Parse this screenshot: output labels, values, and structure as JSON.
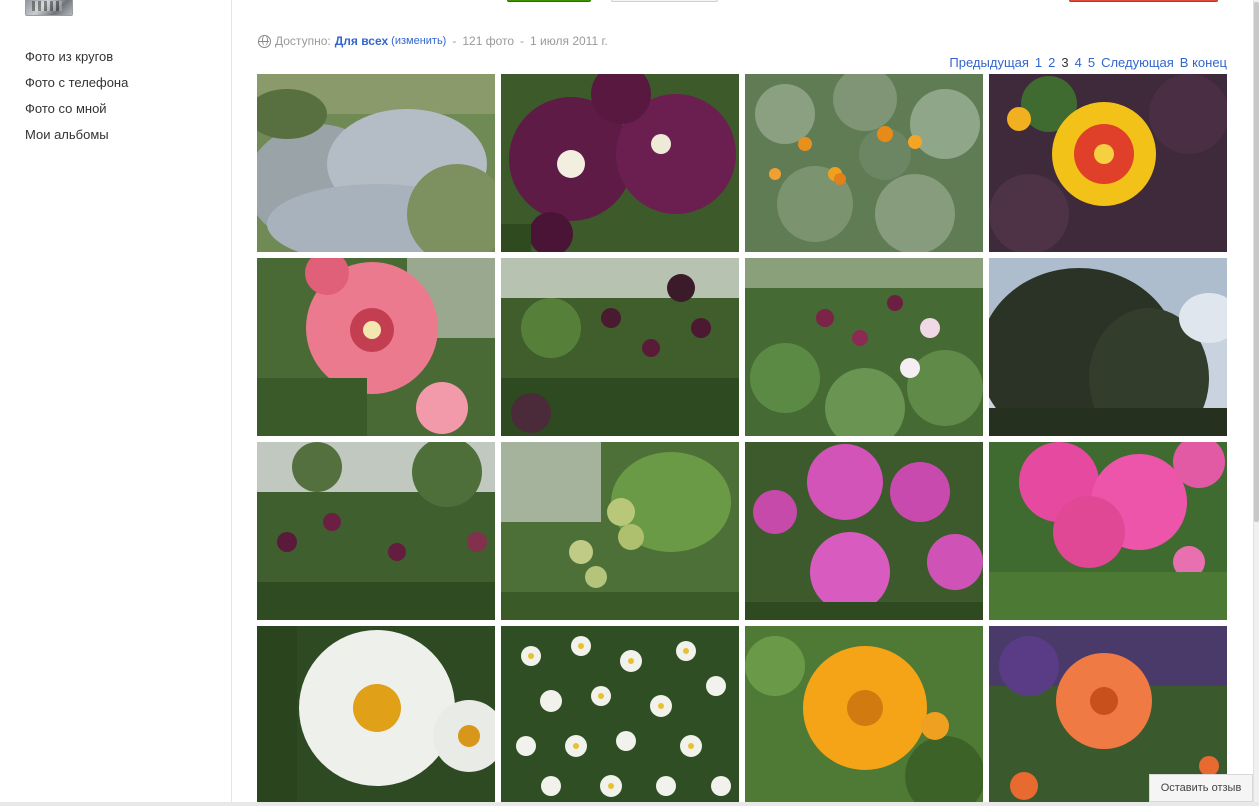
{
  "sidebar": {
    "items": [
      {
        "label": "Фото из кругов"
      },
      {
        "label": "Фото с телефона"
      },
      {
        "label": "Фото со мной"
      },
      {
        "label": "Мои альбомы"
      }
    ]
  },
  "album": {
    "access_label": "Доступно:",
    "audience": "Для всех",
    "change": "(изменить)",
    "separator": "-",
    "photo_count": "121 фото",
    "date": "1 июля 2011 г."
  },
  "pager": {
    "prev": "Предыдущая",
    "pages": [
      "1",
      "2",
      "3",
      "4",
      "5"
    ],
    "current": "3",
    "next": "Следующая",
    "last": "В конец"
  },
  "feedback": {
    "label": "Оставить отзыв"
  },
  "photos": [
    {
      "subject": "lavender-bushes"
    },
    {
      "subject": "dark-purple-hollyhock"
    },
    {
      "subject": "orange-nasturtium-leaves"
    },
    {
      "subject": "yellow-red-nasturtium"
    },
    {
      "subject": "pink-hollyhock"
    },
    {
      "subject": "dark-hollyhock-garden"
    },
    {
      "subject": "hollyhock-garden-pink-white"
    },
    {
      "subject": "tree-silhouette-sky"
    },
    {
      "subject": "tall-hollyhocks"
    },
    {
      "subject": "green-apples-branch"
    },
    {
      "subject": "pink-phlox"
    },
    {
      "subject": "magenta-phlox"
    },
    {
      "subject": "white-daisy"
    },
    {
      "subject": "white-small-daisies"
    },
    {
      "subject": "orange-calendula"
    },
    {
      "subject": "orange-poppy"
    }
  ]
}
